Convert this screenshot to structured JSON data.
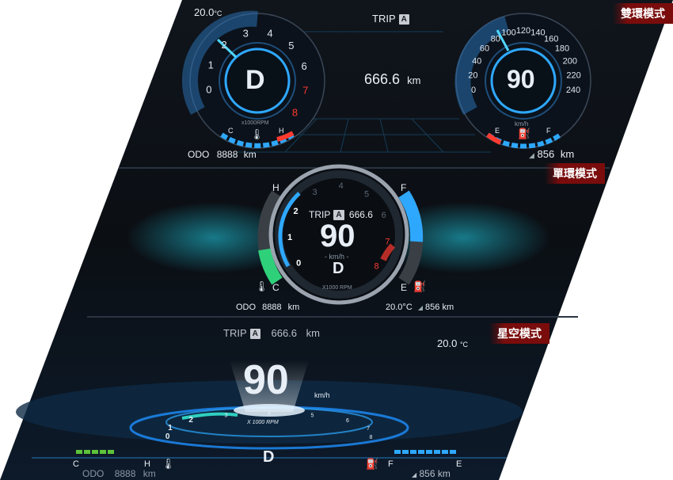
{
  "dual": {
    "mode_label": "雙環模式",
    "temp": "20.0",
    "temp_unit": "°C",
    "trip_label": "TRIP",
    "trip_box": "A",
    "trip_value": "666.6",
    "trip_unit": "km",
    "gear": "D",
    "rpm_ticks": [
      "0",
      "1",
      "2",
      "3",
      "4",
      "5",
      "6",
      "7",
      "8"
    ],
    "rpm_unit": "x1000RPM",
    "coolant_c": "C",
    "coolant_h": "H",
    "odo_label": "ODO",
    "odo_value": "8888",
    "odo_unit": "km",
    "speed": "90",
    "speed_ticks": [
      "0",
      "20",
      "40",
      "60",
      "80",
      "100",
      "120",
      "140",
      "160",
      "180",
      "200",
      "220",
      "240"
    ],
    "speed_unit": "km/h",
    "fuel_e": "E",
    "fuel_f": "F",
    "range_value": "856",
    "range_unit": "km"
  },
  "single": {
    "mode_label": "單環模式",
    "h_label": "H",
    "c_label": "C",
    "f_label": "F",
    "e_label": "E",
    "trip_label": "TRIP",
    "trip_box": "A",
    "trip_value": "666.6",
    "speed": "90",
    "speed_unit": "- km/h -",
    "gear": "D",
    "rpm_unit": "X1000 RPM",
    "rpm_ticks": [
      "0",
      "1",
      "2",
      "3",
      "4",
      "5",
      "6",
      "7",
      "8"
    ],
    "odo_label": "ODO",
    "odo_value": "8888",
    "odo_unit": "km",
    "temp": "20.0",
    "temp_unit": "°C",
    "range_value": "856",
    "range_unit": "km"
  },
  "star": {
    "mode_label": "星空模式",
    "trip_label": "TRIP",
    "trip_box": "A",
    "trip_value": "666.6",
    "trip_unit": "km",
    "temp": "20.0",
    "temp_unit": "°C",
    "speed": "90",
    "speed_unit": "km/h",
    "rpm_unit": "X 1000 RPM",
    "rpm_ticks": [
      "0",
      "1",
      "2",
      "3",
      "4",
      "5",
      "6",
      "7",
      "8"
    ],
    "gear": "D",
    "c_label": "C",
    "h_label": "H",
    "f_label": "F",
    "e_label": "E",
    "odo_label": "ODO",
    "odo_value": "8888",
    "odo_unit": "km",
    "range_value": "856",
    "range_unit": "km"
  },
  "colors": {
    "accent_blue": "#2ea8ff",
    "warning_red": "#ff3b30",
    "coolant_green": "#2fd07a",
    "mode_tag_red": "#7a0c0c"
  }
}
